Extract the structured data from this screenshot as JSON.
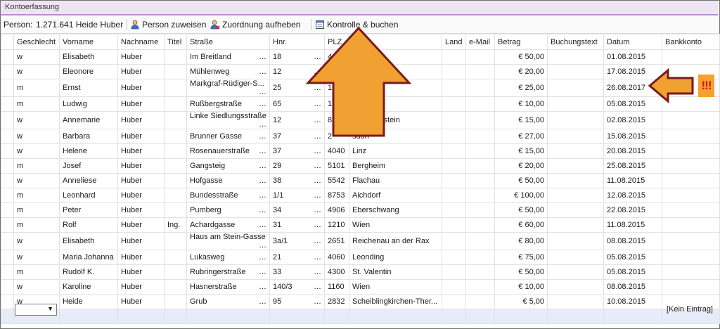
{
  "window": {
    "title": "Kontoerfassung"
  },
  "toolbar": {
    "person_label": "Person:",
    "person_value": "1.271.641 Heide Huber",
    "assign_label": "Person zuweisen",
    "unassign_label": "Zuordnung aufheben",
    "check_label": "Kontrolle & buchen"
  },
  "columns": [
    "Geschlecht",
    "Vorname",
    "Nachname",
    "Titel",
    "Straße",
    "Hnr.",
    "PLZ",
    "Ort",
    "Land",
    "e-Mail",
    "Betrag",
    "Buchungstext",
    "Datum",
    "Bankkonto"
  ],
  "rows": [
    {
      "g": "w",
      "vn": "Elisabeth",
      "nn": "Huber",
      "t": "",
      "str": "Im Breitland",
      "hnr": "18",
      "plz": "4",
      "ort": "",
      "land": "",
      "mail": "",
      "betrag": "€ 50,00",
      "text": "",
      "datum": "01.08.2015",
      "konto": ""
    },
    {
      "g": "w",
      "vn": "Eleonore",
      "nn": "Huber",
      "t": "",
      "str": "Mühlenweg",
      "hnr": "12",
      "plz": "",
      "ort": "",
      "land": "",
      "mail": "",
      "betrag": "€ 20,00",
      "text": "",
      "datum": "17.08.2015",
      "konto": ""
    },
    {
      "g": "m",
      "vn": "Ernst",
      "nn": "Huber",
      "t": "",
      "str": "Markgraf-Rüdiger-S...",
      "hnr": "25",
      "plz": "1",
      "ort": "",
      "land": "",
      "mail": "",
      "betrag": "€ 25,00",
      "text": "",
      "datum": "26.08.2017",
      "konto": ""
    },
    {
      "g": "m",
      "vn": "Ludwig",
      "nn": "Huber",
      "t": "",
      "str": "Rußbergstraße",
      "hnr": "65",
      "plz": "1",
      "ort": "",
      "land": "",
      "mail": "",
      "betrag": "€ 10,00",
      "text": "",
      "datum": "05.08.2015",
      "konto": ""
    },
    {
      "g": "w",
      "vn": "Annemarie",
      "nn": "Huber",
      "t": "",
      "str": "Linke Siedlungsstraße",
      "hnr": "12",
      "plz": "8",
      "ort": "er-Freienstein",
      "land": "",
      "mail": "",
      "betrag": "€ 15,00",
      "text": "",
      "datum": "02.08.2015",
      "konto": ""
    },
    {
      "g": "w",
      "vn": "Barbara",
      "nn": "Huber",
      "t": "",
      "str": "Brunner Gasse",
      "hnr": "37",
      "plz": "2",
      "ort": "sdorf",
      "land": "",
      "mail": "",
      "betrag": "€ 27,00",
      "text": "",
      "datum": "15.08.2015",
      "konto": ""
    },
    {
      "g": "w",
      "vn": "Helene",
      "nn": "Huber",
      "t": "",
      "str": "Rosenauerstraße",
      "hnr": "37",
      "plz": "4040",
      "ort": "Linz",
      "land": "",
      "mail": "",
      "betrag": "€ 15,00",
      "text": "",
      "datum": "20.08.2015",
      "konto": ""
    },
    {
      "g": "m",
      "vn": "Josef",
      "nn": "Huber",
      "t": "",
      "str": "Gangsteig",
      "hnr": "29",
      "plz": "5101",
      "ort": "Bergheim",
      "land": "",
      "mail": "",
      "betrag": "€ 20,00",
      "text": "",
      "datum": "25.08.2015",
      "konto": ""
    },
    {
      "g": "w",
      "vn": "Anneliese",
      "nn": "Huber",
      "t": "",
      "str": "Hofgasse",
      "hnr": "38",
      "plz": "5542",
      "ort": "Flachau",
      "land": "",
      "mail": "",
      "betrag": "€ 50,00",
      "text": "",
      "datum": "11.08.2015",
      "konto": ""
    },
    {
      "g": "m",
      "vn": "Leonhard",
      "nn": "Huber",
      "t": "",
      "str": "Bundesstraße",
      "hnr": "1/1",
      "plz": "8753",
      "ort": "Aichdorf",
      "land": "",
      "mail": "",
      "betrag": "€ 100,00",
      "text": "",
      "datum": "12.08.2015",
      "konto": ""
    },
    {
      "g": "m",
      "vn": "Peter",
      "nn": "Huber",
      "t": "",
      "str": "Pumberg",
      "hnr": "34",
      "plz": "4906",
      "ort": "Eberschwang",
      "land": "",
      "mail": "",
      "betrag": "€ 50,00",
      "text": "",
      "datum": "22.08.2015",
      "konto": ""
    },
    {
      "g": "m",
      "vn": "Rolf",
      "nn": "Huber",
      "t": "Ing.",
      "str": "Achardgasse",
      "hnr": "31",
      "plz": "1210",
      "ort": "Wien",
      "land": "",
      "mail": "",
      "betrag": "€ 60,00",
      "text": "",
      "datum": "11.08.2015",
      "konto": ""
    },
    {
      "g": "w",
      "vn": "Elisabeth",
      "nn": "Huber",
      "t": "",
      "str": "Haus am Stein-Gasse",
      "hnr": "3a/1",
      "plz": "2651",
      "ort": "Reichenau an der Rax",
      "land": "",
      "mail": "",
      "betrag": "€ 80,00",
      "text": "",
      "datum": "08.08.2015",
      "konto": ""
    },
    {
      "g": "w",
      "vn": "Maria Johanna",
      "nn": "Huber",
      "t": "",
      "str": "Lukasweg",
      "hnr": "21",
      "plz": "4060",
      "ort": "Leonding",
      "land": "",
      "mail": "",
      "betrag": "€ 75,00",
      "text": "",
      "datum": "05.08.2015",
      "konto": ""
    },
    {
      "g": "m",
      "vn": "Rudolf K.",
      "nn": "Huber",
      "t": "",
      "str": "Rubringerstraße",
      "hnr": "33",
      "plz": "4300",
      "ort": "St. Valentin",
      "land": "",
      "mail": "",
      "betrag": "€ 50,00",
      "text": "",
      "datum": "05.08.2015",
      "konto": ""
    },
    {
      "g": "w",
      "vn": "Karoline",
      "nn": "Huber",
      "t": "",
      "str": "Hasnerstraße",
      "hnr": "140/3",
      "plz": "1160",
      "ort": "Wien",
      "land": "",
      "mail": "",
      "betrag": "€ 10,00",
      "text": "",
      "datum": "08.08.2015",
      "konto": ""
    },
    {
      "g": "w",
      "vn": "Heide",
      "nn": "Huber",
      "t": "",
      "str": "Grub",
      "hnr": "95",
      "plz": "2832",
      "ort": "Scheiblingkirchen-Ther...",
      "land": "",
      "mail": "",
      "betrag": "€ 5,00",
      "text": "",
      "datum": "10.08.2015",
      "konto": ""
    }
  ],
  "new_row": {
    "combo_arrow": "▼",
    "empty_text": "[Kein Eintrag]"
  },
  "annotation": {
    "marks": "!!!",
    "arrow_color": "#f0a131",
    "arrow_border": "#7a1a1a",
    "mark_color": "#d01616"
  },
  "colors": {
    "title_bg": "#efe4f3",
    "title_border": "#b98bc8",
    "new_row_bg": "#e7ecf8"
  }
}
